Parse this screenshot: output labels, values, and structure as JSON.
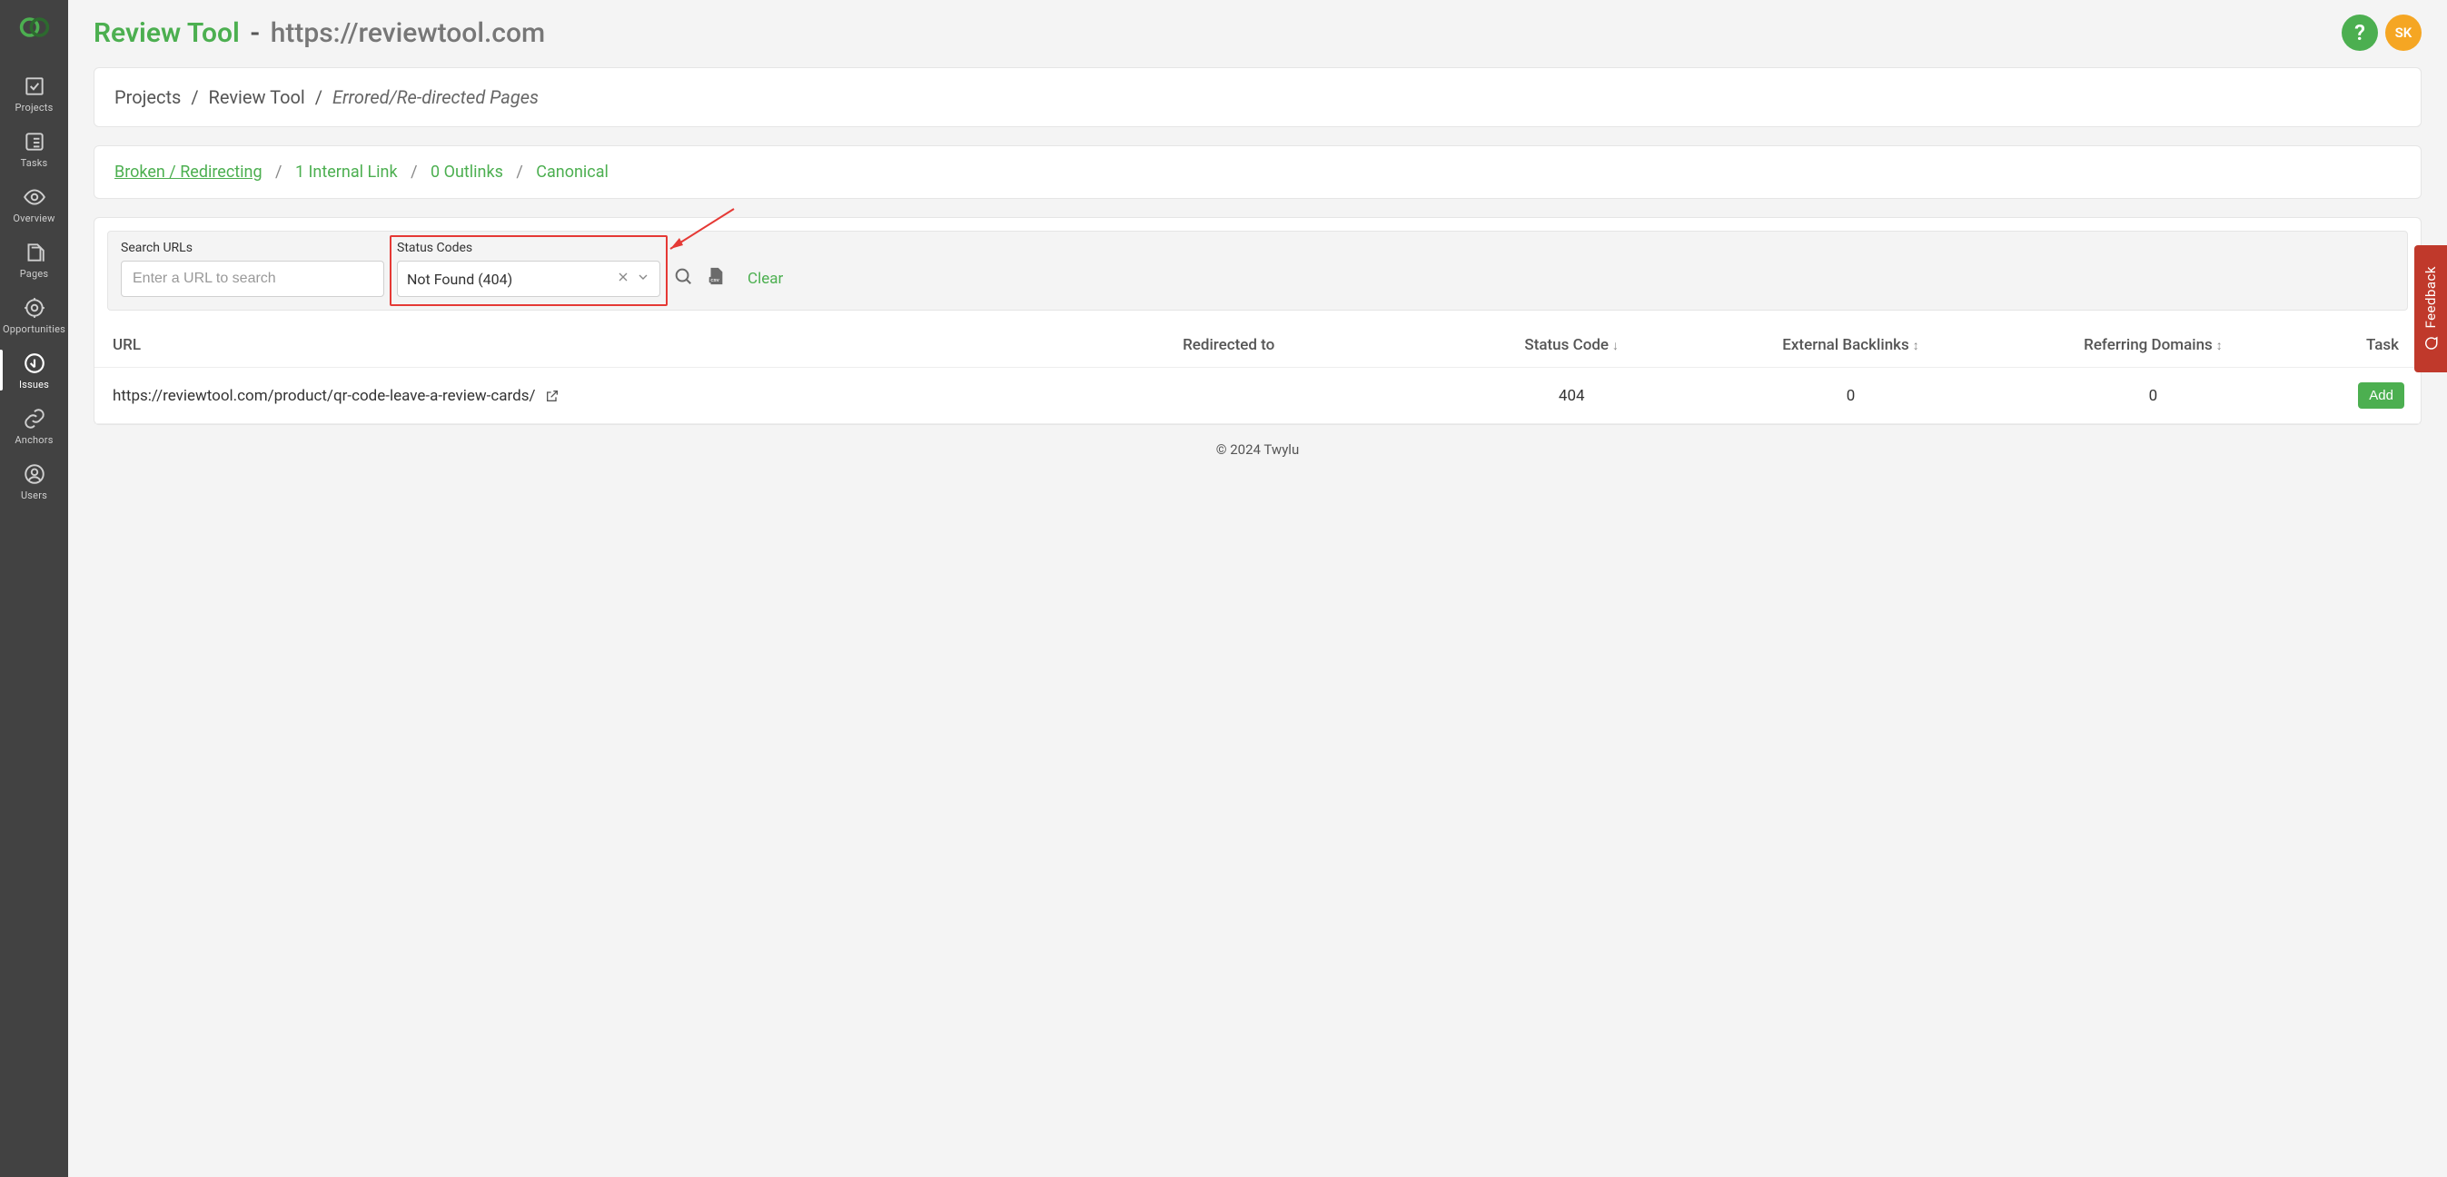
{
  "sidebar": {
    "items": [
      {
        "label": "Projects"
      },
      {
        "label": "Tasks"
      },
      {
        "label": "Overview"
      },
      {
        "label": "Pages"
      },
      {
        "label": "Opportunities"
      },
      {
        "label": "Issues"
      },
      {
        "label": "Anchors"
      },
      {
        "label": "Users"
      }
    ]
  },
  "header": {
    "project_name": "Review Tool",
    "separator": "-",
    "project_url": "https://reviewtool.com",
    "avatar_initials": "SK",
    "help_symbol": "?"
  },
  "breadcrumb": {
    "root": "Projects",
    "project": "Review Tool",
    "page": "Errored/Re-directed Pages",
    "sep": "/"
  },
  "tabs": {
    "items": [
      {
        "label": "Broken / Redirecting",
        "active": true
      },
      {
        "label": "1 Internal Link"
      },
      {
        "label": "0 Outlinks"
      },
      {
        "label": "Canonical"
      }
    ],
    "sep": "/"
  },
  "filters": {
    "search_label": "Search URLs",
    "search_placeholder": "Enter a URL to search",
    "status_label": "Status Codes",
    "status_value": "Not Found (404)",
    "clear_label": "Clear"
  },
  "table": {
    "headers": {
      "url": "URL",
      "redirected": "Redirected to",
      "status": "Status Code",
      "backlinks": "External Backlinks",
      "domains": "Referring Domains",
      "task": "Task"
    },
    "rows": [
      {
        "url": "https://reviewtool.com/product/qr-code-leave-a-review-cards/",
        "redirected": "",
        "status": "404",
        "backlinks": "0",
        "domains": "0",
        "task_label": "Add"
      }
    ]
  },
  "footer": {
    "text": "© 2024 Twylu"
  },
  "feedback": {
    "label": "Feedback"
  }
}
